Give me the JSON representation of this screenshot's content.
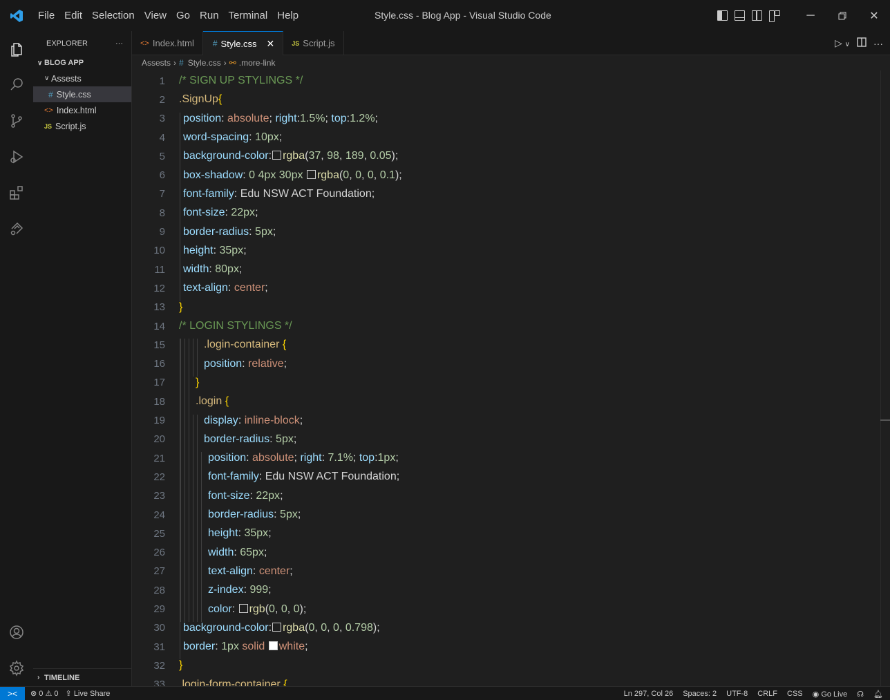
{
  "window": {
    "title": "Style.css - Blog App - Visual Studio Code",
    "menu": [
      "File",
      "Edit",
      "Selection",
      "View",
      "Go",
      "Run",
      "Terminal",
      "Help"
    ]
  },
  "sidebar": {
    "header": "EXPLORER",
    "more": "···",
    "project": "BLOG APP",
    "folder": "Assests",
    "files": [
      {
        "name": "Style.css",
        "type": "css",
        "selected": true
      },
      {
        "name": "Index.html",
        "type": "html",
        "selected": false
      },
      {
        "name": "Script.js",
        "type": "js",
        "selected": false
      }
    ],
    "timeline": "TIMELINE"
  },
  "tabs": [
    {
      "label": "Index.html",
      "icon": "html",
      "active": false
    },
    {
      "label": "Style.css",
      "icon": "css",
      "active": true
    },
    {
      "label": "Script.js",
      "icon": "js",
      "active": false
    }
  ],
  "breadcrumb": {
    "folder": "Assests",
    "file": "Style.css",
    "symbol": ".more-link"
  },
  "editor": {
    "lines": [
      {
        "n": "1",
        "indent": 0,
        "tokens": [
          [
            "com",
            "/* SIGN UP STYLINGS */"
          ]
        ]
      },
      {
        "n": "2",
        "indent": 0,
        "tokens": [
          [
            "sel",
            ".SignUp"
          ],
          [
            "brace",
            "{"
          ]
        ]
      },
      {
        "n": "3",
        "indent": 1,
        "tokens": [
          [
            "prop",
            "position"
          ],
          [
            "txt",
            ": "
          ],
          [
            "val",
            "absolute"
          ],
          [
            "txt",
            "; "
          ],
          [
            "prop",
            "right"
          ],
          [
            "txt",
            ":"
          ],
          [
            "num",
            "1.5%"
          ],
          [
            "txt",
            "; "
          ],
          [
            "prop",
            "top"
          ],
          [
            "txt",
            ":"
          ],
          [
            "num",
            "1.2%"
          ],
          [
            "txt",
            ";"
          ]
        ]
      },
      {
        "n": "4",
        "indent": 1,
        "tokens": [
          [
            "prop",
            "word-spacing"
          ],
          [
            "txt",
            ": "
          ],
          [
            "num",
            "10px"
          ],
          [
            "txt",
            ";"
          ]
        ]
      },
      {
        "n": "5",
        "indent": 1,
        "tokens": [
          [
            "prop",
            "background-color"
          ],
          [
            "txt",
            ":"
          ],
          [
            "swatch",
            ""
          ],
          [
            "fn",
            "rgba"
          ],
          [
            "txt",
            "("
          ],
          [
            "num",
            "37"
          ],
          [
            "txt",
            ", "
          ],
          [
            "num",
            "98"
          ],
          [
            "txt",
            ", "
          ],
          [
            "num",
            "189"
          ],
          [
            "txt",
            ", "
          ],
          [
            "num",
            "0.05"
          ],
          [
            "txt",
            ");"
          ]
        ]
      },
      {
        "n": "6",
        "indent": 1,
        "tokens": [
          [
            "prop",
            "box-shadow"
          ],
          [
            "txt",
            ": "
          ],
          [
            "num",
            "0"
          ],
          [
            "txt",
            " "
          ],
          [
            "num",
            "4px"
          ],
          [
            "txt",
            " "
          ],
          [
            "num",
            "30px"
          ],
          [
            "txt",
            " "
          ],
          [
            "swatch",
            ""
          ],
          [
            "fn",
            "rgba"
          ],
          [
            "txt",
            "("
          ],
          [
            "num",
            "0"
          ],
          [
            "txt",
            ", "
          ],
          [
            "num",
            "0"
          ],
          [
            "txt",
            ", "
          ],
          [
            "num",
            "0"
          ],
          [
            "txt",
            ", "
          ],
          [
            "num",
            "0.1"
          ],
          [
            "txt",
            ");"
          ]
        ]
      },
      {
        "n": "7",
        "indent": 1,
        "tokens": [
          [
            "prop",
            "font-family"
          ],
          [
            "txt",
            ": Edu NSW ACT Foundation;"
          ]
        ]
      },
      {
        "n": "8",
        "indent": 1,
        "tokens": [
          [
            "prop",
            "font-size"
          ],
          [
            "txt",
            ": "
          ],
          [
            "num",
            "22px"
          ],
          [
            "txt",
            ";"
          ]
        ]
      },
      {
        "n": "9",
        "indent": 1,
        "tokens": [
          [
            "prop",
            "border-radius"
          ],
          [
            "txt",
            ": "
          ],
          [
            "num",
            "5px"
          ],
          [
            "txt",
            ";"
          ]
        ]
      },
      {
        "n": "10",
        "indent": 1,
        "tokens": [
          [
            "prop",
            "height"
          ],
          [
            "txt",
            ": "
          ],
          [
            "num",
            "35px"
          ],
          [
            "txt",
            ";"
          ]
        ]
      },
      {
        "n": "11",
        "indent": 1,
        "tokens": [
          [
            "prop",
            "width"
          ],
          [
            "txt",
            ": "
          ],
          [
            "num",
            "80px"
          ],
          [
            "txt",
            ";"
          ]
        ]
      },
      {
        "n": "12",
        "indent": 1,
        "tokens": [
          [
            "prop",
            "text-align"
          ],
          [
            "txt",
            ": "
          ],
          [
            "val",
            "center"
          ],
          [
            "txt",
            ";"
          ]
        ]
      },
      {
        "n": "13",
        "indent": 0,
        "tokens": [
          [
            "brace",
            "}"
          ]
        ]
      },
      {
        "n": "14",
        "indent": 0,
        "tokens": [
          [
            "com",
            "/* LOGIN STYLINGS */"
          ]
        ]
      },
      {
        "n": "15",
        "indent": 6,
        "tokens": [
          [
            "sel",
            ".login-container"
          ],
          [
            "txt",
            " "
          ],
          [
            "brace",
            "{"
          ]
        ]
      },
      {
        "n": "16",
        "indent": 6,
        "tokens": [
          [
            "prop",
            "position"
          ],
          [
            "txt",
            ": "
          ],
          [
            "val",
            "relative"
          ],
          [
            "txt",
            ";"
          ]
        ]
      },
      {
        "n": "17",
        "indent": 4,
        "tokens": [
          [
            "brace",
            "}"
          ]
        ]
      },
      {
        "n": "18",
        "indent": 4,
        "tokens": [
          [
            "sel",
            ".login"
          ],
          [
            "txt",
            " "
          ],
          [
            "brace",
            "{"
          ]
        ]
      },
      {
        "n": "19",
        "indent": 6,
        "tokens": [
          [
            "prop",
            "display"
          ],
          [
            "txt",
            ": "
          ],
          [
            "val",
            "inline-block"
          ],
          [
            "txt",
            ";"
          ]
        ]
      },
      {
        "n": "20",
        "indent": 6,
        "tokens": [
          [
            "prop",
            "border-radius"
          ],
          [
            "txt",
            ": "
          ],
          [
            "num",
            "5px"
          ],
          [
            "txt",
            ";"
          ]
        ]
      },
      {
        "n": "21",
        "indent": 7,
        "tokens": [
          [
            "prop",
            "position"
          ],
          [
            "txt",
            ": "
          ],
          [
            "val",
            "absolute"
          ],
          [
            "txt",
            "; "
          ],
          [
            "prop",
            "right"
          ],
          [
            "txt",
            ": "
          ],
          [
            "num",
            "7.1%"
          ],
          [
            "txt",
            "; "
          ],
          [
            "prop",
            "top"
          ],
          [
            "txt",
            ":"
          ],
          [
            "num",
            "1px"
          ],
          [
            "txt",
            ";"
          ]
        ]
      },
      {
        "n": "22",
        "indent": 7,
        "tokens": [
          [
            "prop",
            "font-family"
          ],
          [
            "txt",
            ": Edu NSW ACT Foundation;"
          ]
        ]
      },
      {
        "n": "23",
        "indent": 7,
        "tokens": [
          [
            "prop",
            "font-size"
          ],
          [
            "txt",
            ": "
          ],
          [
            "num",
            "22px"
          ],
          [
            "txt",
            ";"
          ]
        ]
      },
      {
        "n": "24",
        "indent": 7,
        "tokens": [
          [
            "prop",
            "border-radius"
          ],
          [
            "txt",
            ": "
          ],
          [
            "num",
            "5px"
          ],
          [
            "txt",
            ";"
          ]
        ]
      },
      {
        "n": "25",
        "indent": 7,
        "tokens": [
          [
            "prop",
            "height"
          ],
          [
            "txt",
            ": "
          ],
          [
            "num",
            "35px"
          ],
          [
            "txt",
            ";"
          ]
        ]
      },
      {
        "n": "26",
        "indent": 7,
        "tokens": [
          [
            "prop",
            "width"
          ],
          [
            "txt",
            ": "
          ],
          [
            "num",
            "65px"
          ],
          [
            "txt",
            ";"
          ]
        ]
      },
      {
        "n": "27",
        "indent": 7,
        "tokens": [
          [
            "prop",
            "text-align"
          ],
          [
            "txt",
            ": "
          ],
          [
            "val",
            "center"
          ],
          [
            "txt",
            ";"
          ]
        ]
      },
      {
        "n": "28",
        "indent": 7,
        "tokens": [
          [
            "prop",
            "z-index"
          ],
          [
            "txt",
            ": "
          ],
          [
            "num",
            "999"
          ],
          [
            "txt",
            ";"
          ]
        ]
      },
      {
        "n": "29",
        "indent": 7,
        "tokens": [
          [
            "prop",
            "color"
          ],
          [
            "txt",
            ": "
          ],
          [
            "swatch",
            ""
          ],
          [
            "fn",
            "rgb"
          ],
          [
            "txt",
            "("
          ],
          [
            "num",
            "0"
          ],
          [
            "txt",
            ", "
          ],
          [
            "num",
            "0"
          ],
          [
            "txt",
            ", "
          ],
          [
            "num",
            "0"
          ],
          [
            "txt",
            ");"
          ]
        ]
      },
      {
        "n": "30",
        "indent": 1,
        "tokens": [
          [
            "prop",
            "background-color"
          ],
          [
            "txt",
            ":"
          ],
          [
            "swatch",
            ""
          ],
          [
            "fn",
            "rgba"
          ],
          [
            "txt",
            "("
          ],
          [
            "num",
            "0"
          ],
          [
            "txt",
            ", "
          ],
          [
            "num",
            "0"
          ],
          [
            "txt",
            ", "
          ],
          [
            "num",
            "0"
          ],
          [
            "txt",
            ", "
          ],
          [
            "num",
            "0.798"
          ],
          [
            "txt",
            ");"
          ]
        ]
      },
      {
        "n": "31",
        "indent": 1,
        "tokens": [
          [
            "prop",
            "border"
          ],
          [
            "txt",
            ": "
          ],
          [
            "num",
            "1px"
          ],
          [
            "txt",
            " "
          ],
          [
            "val",
            "solid"
          ],
          [
            "txt",
            " "
          ],
          [
            "swatchw",
            ""
          ],
          [
            "val",
            "white"
          ],
          [
            "txt",
            ";"
          ]
        ]
      },
      {
        "n": "32",
        "indent": 0,
        "tokens": [
          [
            "brace",
            "}"
          ]
        ]
      },
      {
        "n": "33",
        "indent": 0,
        "tokens": [
          [
            "sel",
            ".login-form-container"
          ],
          [
            "txt",
            " "
          ],
          [
            "brace",
            "{"
          ]
        ]
      }
    ]
  },
  "statusbar": {
    "remote_icon": "><",
    "errors": "0",
    "warnings": "0",
    "live_share": "Live Share",
    "position": "Ln 297, Col 26",
    "spaces": "Spaces: 2",
    "encoding": "UTF-8",
    "eol": "CRLF",
    "language": "CSS",
    "go_live": "Go Live"
  },
  "colors": {
    "accent": "#0078d4",
    "background": "#1f1f1f",
    "chrome": "#181818"
  }
}
